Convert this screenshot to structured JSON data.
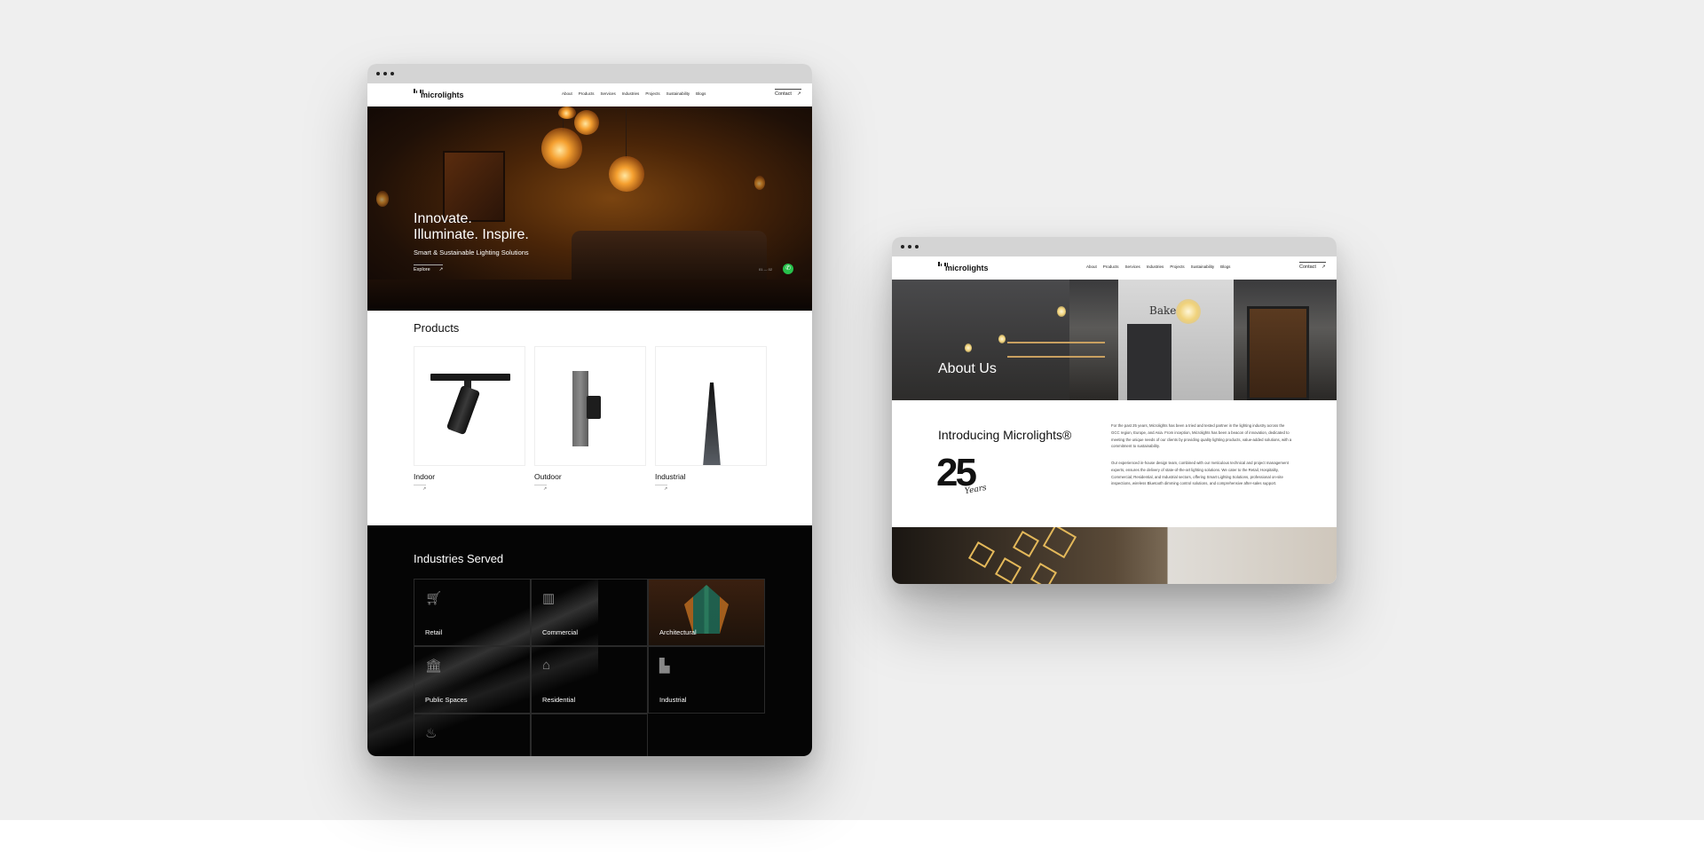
{
  "brand": {
    "name": "microlights"
  },
  "nav": {
    "items": [
      "About",
      "Products",
      "Services",
      "Industries",
      "Projects",
      "Sustainability",
      "Blogs"
    ],
    "contact_label": "Contact",
    "contact_icon": "arrow-up-right-icon"
  },
  "hero": {
    "title_line1": "Innovate.",
    "title_line2": "Illuminate. Inspire.",
    "subtitle": "Smart & Sustainable Lighting Solutions",
    "cta_label": "Explore",
    "pager": "01 — 02"
  },
  "products": {
    "title": "Products",
    "items": [
      {
        "label": "Indoor"
      },
      {
        "label": "Outdoor"
      },
      {
        "label": "Industrial"
      }
    ]
  },
  "industries": {
    "title": "Industries Served",
    "items": [
      {
        "label": "Retail",
        "icon": "shopping-cart-icon"
      },
      {
        "label": "Commercial",
        "icon": "building-icon"
      },
      {
        "label": "Architectural",
        "icon": ""
      },
      {
        "label": "Public Spaces",
        "icon": "bank-icon"
      },
      {
        "label": "Residential",
        "icon": "house-icon"
      },
      {
        "label": "Industrial",
        "icon": "factory-icon"
      },
      {
        "label": "",
        "icon": "hospitality-icon"
      }
    ]
  },
  "about": {
    "hero_title": "About Us",
    "sign_text": "Bake",
    "intro_title": "Introducing Microlights®",
    "years_number": "25",
    "years_script": "Years",
    "paragraph1": "For the past 25 years, Microlights has been a tried and tested partner in the lighting industry across the GCC region, Europe, and Asia. From inception, Microlights has been a beacon of innovation, dedicated to meeting the unique needs of our clients by providing quality lighting products, value-added solutions, with a commitment to sustainability.",
    "paragraph2": "Our experienced in-house design team, combined with our meticulous technical and project management experts, ensures the delivery of state-of-the-art lighting solutions. We cater to the Retail, Hospitality, Commercial, Residential, and Industrial sectors, offering Smart Lighting Solutions, professional on-site inspections, wireless Bluetooth dimming control solutions, and comprehensive after-sales support."
  },
  "colors": {
    "page_bg": "#efefef",
    "titlebar": "#d4d4d4",
    "dark_section": "#050505",
    "whatsapp": "#27c24c",
    "accent_gold": "#e3b85a"
  }
}
